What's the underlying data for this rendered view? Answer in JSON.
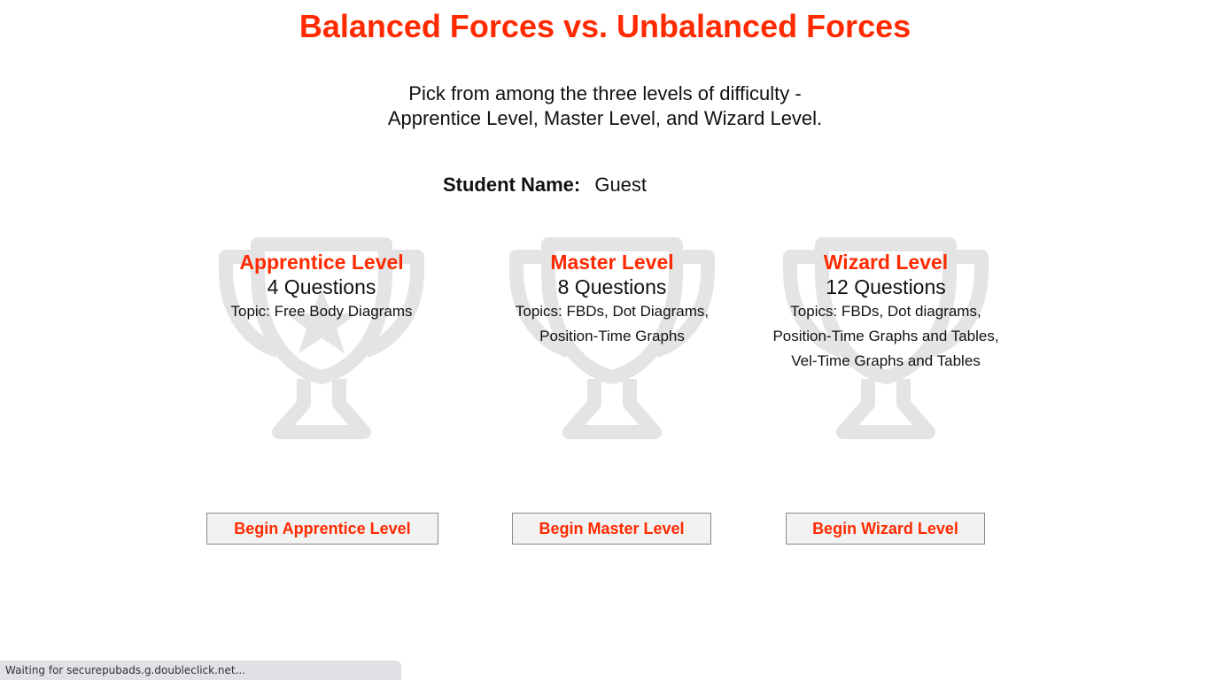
{
  "page": {
    "title": "Balanced Forces vs. Unbalanced Forces",
    "subtitle_line1": "Pick from among the three levels of difficulty -",
    "subtitle_line2": "Apprentice Level, Master Level, and Wizard Level."
  },
  "student": {
    "label": "Student Name:",
    "value": "Guest"
  },
  "levels": [
    {
      "name": "Apprentice Level",
      "count": "4 Questions",
      "topics": [
        "Topic: Free Body Diagrams"
      ],
      "button_label": "Begin Apprentice Level",
      "icon": "trophy-star-icon"
    },
    {
      "name": "Master Level",
      "count": "8 Questions",
      "topics": [
        "Topics: FBDs, Dot Diagrams,",
        "Position-Time Graphs"
      ],
      "button_label": "Begin Master Level",
      "icon": "trophy-icon"
    },
    {
      "name": "Wizard Level",
      "count": "12 Questions",
      "topics": [
        "Topics: FBDs, Dot diagrams,",
        "Position-Time Graphs and Tables,",
        "Vel-Time Graphs and Tables"
      ],
      "button_label": "Begin Wizard Level",
      "icon": "trophy-icon"
    }
  ],
  "statusbar": {
    "text": "Waiting for securepubads.g.doubleclick.net..."
  },
  "colors": {
    "accent": "#ff2a00",
    "trophy": "#e4e4e4",
    "button_bg": "#f2f2f2"
  }
}
